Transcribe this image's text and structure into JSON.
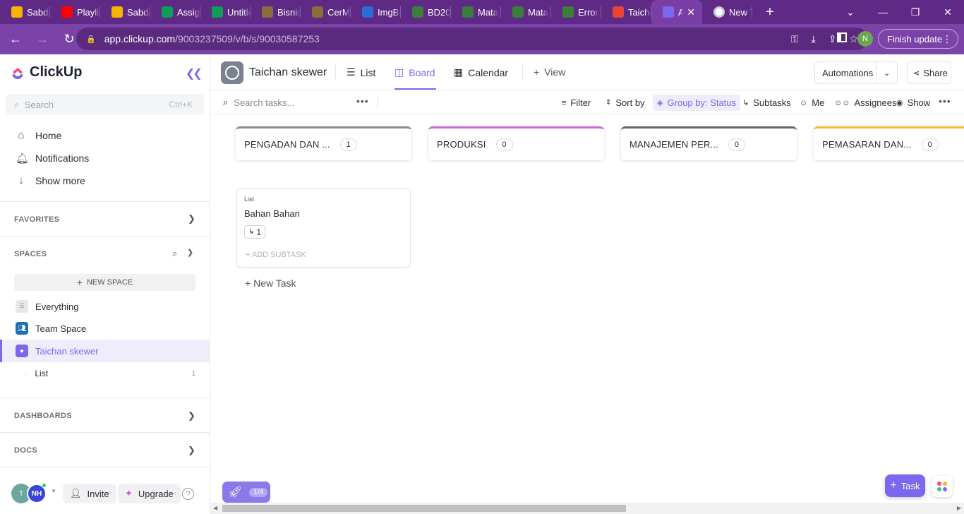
{
  "browser": {
    "tabs": [
      {
        "title": "Sabda",
        "icon": "google-drive-icon",
        "color": "#f4b400"
      },
      {
        "title": "Playlis",
        "icon": "youtube-icon",
        "color": "#ff0000"
      },
      {
        "title": "Sabda",
        "icon": "google-drive-icon",
        "color": "#f4b400"
      },
      {
        "title": "Assign",
        "icon": "google-sheets-icon",
        "color": "#0f9d58"
      },
      {
        "title": "Untitle",
        "icon": "google-sheets-icon",
        "color": "#0f9d58"
      },
      {
        "title": "Bisnis",
        "icon": "page-icon",
        "color": "#8a6d3b"
      },
      {
        "title": "CerMi",
        "icon": "page-icon",
        "color": "#8a6d3b"
      },
      {
        "title": "ImgBB",
        "icon": "imgbb-icon",
        "color": "#2b6cd6"
      },
      {
        "title": "BD20",
        "icon": "page-icon",
        "color": "#3b7d3b"
      },
      {
        "title": "Mata",
        "icon": "page-icon",
        "color": "#3b7d3b"
      },
      {
        "title": "Mata",
        "icon": "page-icon",
        "color": "#3b7d3b"
      },
      {
        "title": "Error",
        "icon": "page-icon",
        "color": "#3b7d3b"
      },
      {
        "title": "Taicha",
        "icon": "gmail-icon",
        "color": "#ea4335"
      },
      {
        "title": "A",
        "icon": "clickup-icon",
        "color": "#7b68ee",
        "active": true
      },
      {
        "title": "New T",
        "icon": "chrome-icon",
        "color": "#ffffff"
      }
    ],
    "url_host": "app.clickup.com",
    "url_path": "/9003237509/v/b/s/90030587253",
    "profile_initial": "N",
    "finish_update": "Finish update"
  },
  "sidebar": {
    "brand": "ClickUp",
    "search_placeholder": "Search",
    "search_shortcut": "Ctrl+K",
    "nav": [
      {
        "label": "Home",
        "icon": "home-icon"
      },
      {
        "label": "Notifications",
        "icon": "bell-icon"
      },
      {
        "label": "Show more",
        "icon": "arrow-down-icon"
      }
    ],
    "favorites": "FAVORITES",
    "spaces": "SPACES",
    "new_space": "NEW SPACE",
    "space_items": [
      {
        "label": "Everything",
        "color": "#e6e7ea"
      },
      {
        "label": "Team Space",
        "color": "#1f6fb5"
      },
      {
        "label": "Taichan skewer",
        "color": "#7b68ee"
      }
    ],
    "list_item": {
      "label": "List",
      "count": "1"
    },
    "dashboards": "DASHBOARDS",
    "docs": "DOCS",
    "user_initials_1": "T",
    "user_initials_2": "NH",
    "invite": "Invite",
    "upgrade": "Upgrade"
  },
  "header": {
    "title": "Taichan skewer",
    "tabs": [
      "List",
      "Board",
      "Calendar"
    ],
    "add_view": "View",
    "automations": "Automations",
    "share": "Share"
  },
  "toolbar": {
    "search_placeholder": "Search tasks...",
    "filter": "Filter",
    "sort_by": "Sort by",
    "group_by": "Group by: Status",
    "subtasks": "Subtasks",
    "me": "Me",
    "assignees": "Assignees",
    "show": "Show"
  },
  "board": {
    "columns": [
      {
        "name": "PENGADAN DAN ...",
        "count": "1",
        "color": "#878c96"
      },
      {
        "name": "PRODUKSI",
        "count": "0",
        "color": "#c26ad6"
      },
      {
        "name": "MANAJEMEN PER...",
        "count": "0",
        "color": "#5f6670"
      },
      {
        "name": "PEMASARAN DAN...",
        "count": "0",
        "color": "#f5b731"
      }
    ],
    "card": {
      "list_label": "List",
      "title": "Bahan Bahan",
      "subtask_count": "1",
      "add_subtask": "+ ADD SUBTASK"
    },
    "new_task": "+ New Task"
  },
  "footer": {
    "onboarding_progress": "1/4",
    "task_button": "Task"
  }
}
